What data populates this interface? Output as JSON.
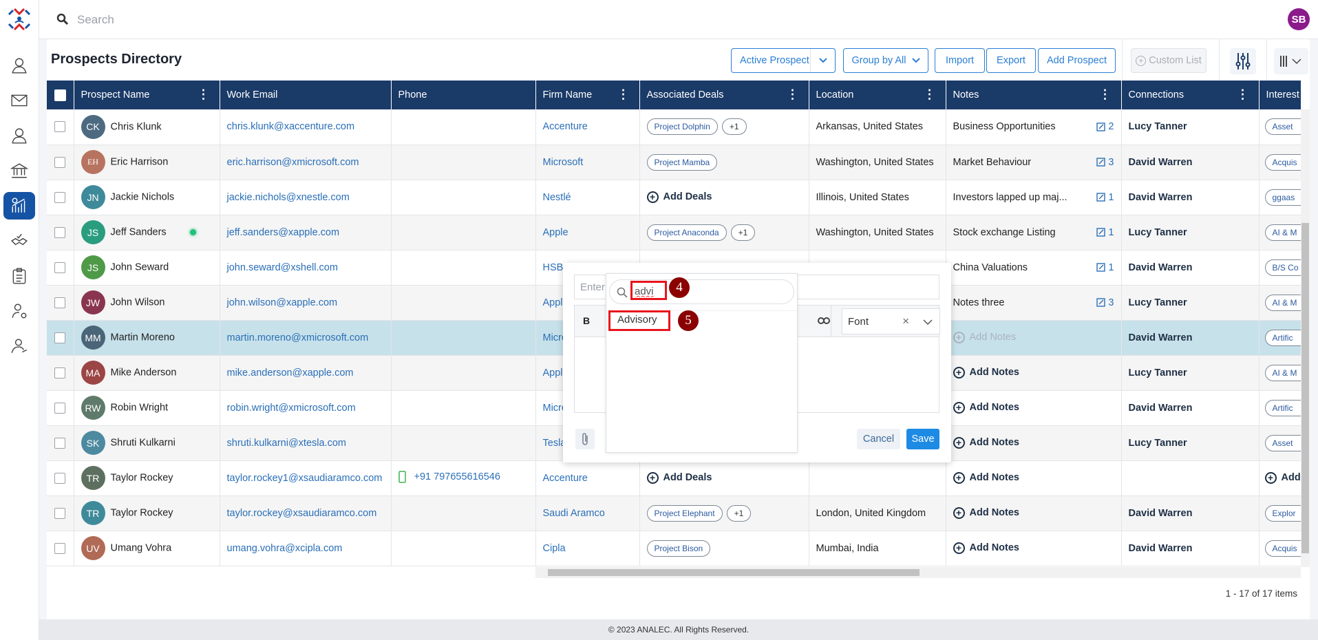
{
  "app": {
    "search_placeholder": "Search",
    "user_initials": "SB",
    "user_color": "#8b1a8b",
    "brand_color": "#1a3a68",
    "accent_color": "#2a7fd4"
  },
  "sidebar": {
    "items": [
      {
        "icon": "contacts-icon"
      },
      {
        "icon": "mail-icon"
      },
      {
        "icon": "user-icon"
      },
      {
        "icon": "bank-icon"
      },
      {
        "icon": "analytics-icon",
        "active": true
      },
      {
        "icon": "handshake-icon"
      },
      {
        "icon": "clipboard-icon"
      },
      {
        "icon": "user-settings-icon"
      },
      {
        "icon": "user-share-icon"
      }
    ]
  },
  "header": {
    "title": "Prospects Directory",
    "active_prospect": "Active Prospect",
    "group_by": "Group by All",
    "import": "Import",
    "export": "Export",
    "add_prospect": "Add Prospect",
    "custom_list": "Custom List"
  },
  "table": {
    "columns": [
      "Prospect Name",
      "Work Email",
      "Phone",
      "Firm Name",
      "Associated Deals",
      "Location",
      "Notes",
      "Connections",
      "Interest"
    ],
    "add_deals": "Add Deals",
    "add_notes": "Add Notes",
    "add": "Add",
    "rows": [
      {
        "initials": "CK",
        "color": "#4d6a80",
        "name": "Chris Klunk",
        "email": "chris.klunk@xaccenture.com",
        "phone": "",
        "firm": "Accenture",
        "deals": [
          "Project Dolphin"
        ],
        "more": "+1",
        "location": "Arkansas, United States",
        "note": "Business Opportunities",
        "note_count": "2",
        "connection": "Lucy Tanner",
        "interest": "Asset"
      },
      {
        "initials": "EH",
        "color": "#b87360",
        "serif": true,
        "name": "Eric Harrison",
        "email": "eric.harrison@xmicrosoft.com",
        "phone": "",
        "firm": "Microsoft",
        "deals": [
          "Project Mamba"
        ],
        "location": "Washington, United States",
        "note": "Market Behaviour",
        "note_count": "3",
        "connection": "David Warren",
        "interest": "Acquis"
      },
      {
        "initials": "JN",
        "color": "#3e8a9a",
        "name": "Jackie Nichols",
        "email": "jackie.nichols@xnestle.com",
        "phone": "",
        "firm": "Nestlé",
        "deals": [],
        "location": "Illinois, United States",
        "note": "Investors lapped up maj...",
        "note_count": "1",
        "connection": "David Warren",
        "interest": "ggaas"
      },
      {
        "initials": "JS",
        "color": "#2a9d7f",
        "name": "Jeff Sanders",
        "online": true,
        "email": "jeff.sanders@xapple.com",
        "phone": "",
        "firm": "Apple",
        "deals": [
          "Project Anaconda"
        ],
        "more": "+1",
        "location": "Washington, United States",
        "note": "Stock exchange Listing",
        "note_count": "1",
        "connection": "Lucy Tanner",
        "interest": "AI & M"
      },
      {
        "initials": "JS",
        "color": "#4f9a48",
        "name": "John Seward",
        "email": "john.seward@xshell.com",
        "phone": "",
        "firm": "HSBC",
        "location": "",
        "note": "China Valuations",
        "note_count": "1",
        "connection": "David Warren",
        "interest": "B/S Co"
      },
      {
        "initials": "JW",
        "color": "#8a3550",
        "name": "John Wilson",
        "email": "john.wilson@xapple.com",
        "phone": "",
        "firm": "Apple",
        "location": "",
        "note": "Notes three",
        "note_count": "3",
        "connection": "Lucy Tanner",
        "interest": "AI & M"
      },
      {
        "initials": "MM",
        "color": "#4a6478",
        "name": "Martin Moreno",
        "selected": true,
        "email": "martin.moreno@xmicrosoft.com",
        "phone": "",
        "firm": "Micro",
        "location": "",
        "note": "",
        "connection": "David Warren",
        "interest": "Artific"
      },
      {
        "initials": "MA",
        "color": "#9c4545",
        "name": "Mike Anderson",
        "email": "mike.anderson@xapple.com",
        "phone": "",
        "firm": "Apple",
        "location": "",
        "note": "",
        "connection": "Lucy Tanner",
        "interest": "AI & M"
      },
      {
        "initials": "RW",
        "color": "#5f7a6a",
        "name": "Robin Wright",
        "email": "robin.wright@xmicrosoft.com",
        "phone": "",
        "firm": "Micro",
        "location": "",
        "note": "",
        "connection": "David Warren",
        "interest": "Artific"
      },
      {
        "initials": "SK",
        "color": "#4d8aa0",
        "name": "Shruti Kulkarni",
        "email": "shruti.kulkarni@xtesla.com",
        "phone": "",
        "firm": "Tesla",
        "location": "",
        "note": "",
        "connection": "Lucy Tanner",
        "interest": "Asset"
      },
      {
        "initials": "TR",
        "color": "#5d7060",
        "name": "Taylor Rockey",
        "email": "taylor.rockey1@xsaudiaramco.com",
        "phone": "+91 797655616546",
        "firm": "Accenture",
        "deals": [],
        "location": "",
        "note": "",
        "connection": "",
        "interest": ""
      },
      {
        "initials": "TR",
        "color": "#3e8a9a",
        "name": "Taylor Rockey",
        "email": "taylor.rockey@xsaudiaramco.com",
        "phone": "",
        "firm": "Saudi Aramco",
        "deals": [
          "Project Elephant"
        ],
        "more": "+1",
        "location": "London, United Kingdom",
        "note": "",
        "connection": "David Warren",
        "interest": "Explor"
      },
      {
        "initials": "UV",
        "color": "#b06a55",
        "name": "Umang Vohra",
        "email": "umang.vohra@xcipla.com",
        "phone": "",
        "firm": "Cipla",
        "deals": [
          "Project Bison"
        ],
        "location": "Mumbai, India",
        "note": "",
        "connection": "David Warren",
        "interest": "Acquis"
      }
    ],
    "pager": "1 - 17 of 17 items"
  },
  "note_popup": {
    "title_placeholder": "Enter",
    "bold": "B",
    "font": "Font",
    "cancel": "Cancel",
    "save": "Save",
    "tag_dropdown": {
      "search_value": "advi",
      "options": [
        "Advisory"
      ]
    }
  },
  "annotations": {
    "step_search": "4",
    "step_option": "5",
    "highlight_color": "#e8141b"
  },
  "footer": "© 2023 ANALEC. All Rights Reserved."
}
